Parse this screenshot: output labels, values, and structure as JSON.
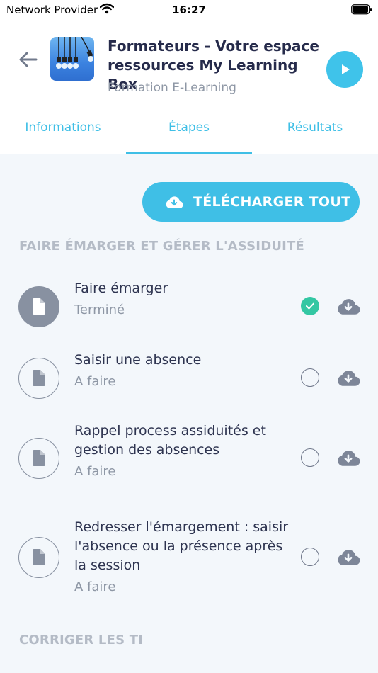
{
  "status_bar": {
    "carrier": "Network Provider",
    "time": "16:27"
  },
  "header": {
    "title": "Formateurs - Votre espace ressources My Learning Box",
    "subtitle": "Formation E-Learning"
  },
  "tabs": [
    {
      "label": "Informations",
      "active": false
    },
    {
      "label": "Étapes",
      "active": true
    },
    {
      "label": "Résultats",
      "active": false
    }
  ],
  "download_all_label": "TÉLÉCHARGER TOUT",
  "sections": [
    {
      "title": "FAIRE ÉMARGER ET GÉRER L'ASSIDUITÉ",
      "steps": [
        {
          "title": "Faire émarger",
          "state": "Terminé",
          "done": true
        },
        {
          "title": "Saisir une absence",
          "state": "A faire",
          "done": false
        },
        {
          "title": "Rappel process assiduités et gestion des absences",
          "state": "A faire",
          "done": false
        },
        {
          "title": "Redresser l'émargement : saisir l'absence ou la présence après la session",
          "state": "A faire",
          "done": false
        }
      ]
    },
    {
      "title": "CORRIGER LES TI"
    }
  ],
  "colors": {
    "accent": "#3fbfe6",
    "done": "#33c7a3",
    "text": "#2e3450",
    "muted": "#8e97a5"
  },
  "icons": [
    "wifi-icon",
    "battery-icon",
    "back-arrow-icon",
    "play-icon",
    "cloud-download-icon",
    "document-icon",
    "check-icon"
  ]
}
